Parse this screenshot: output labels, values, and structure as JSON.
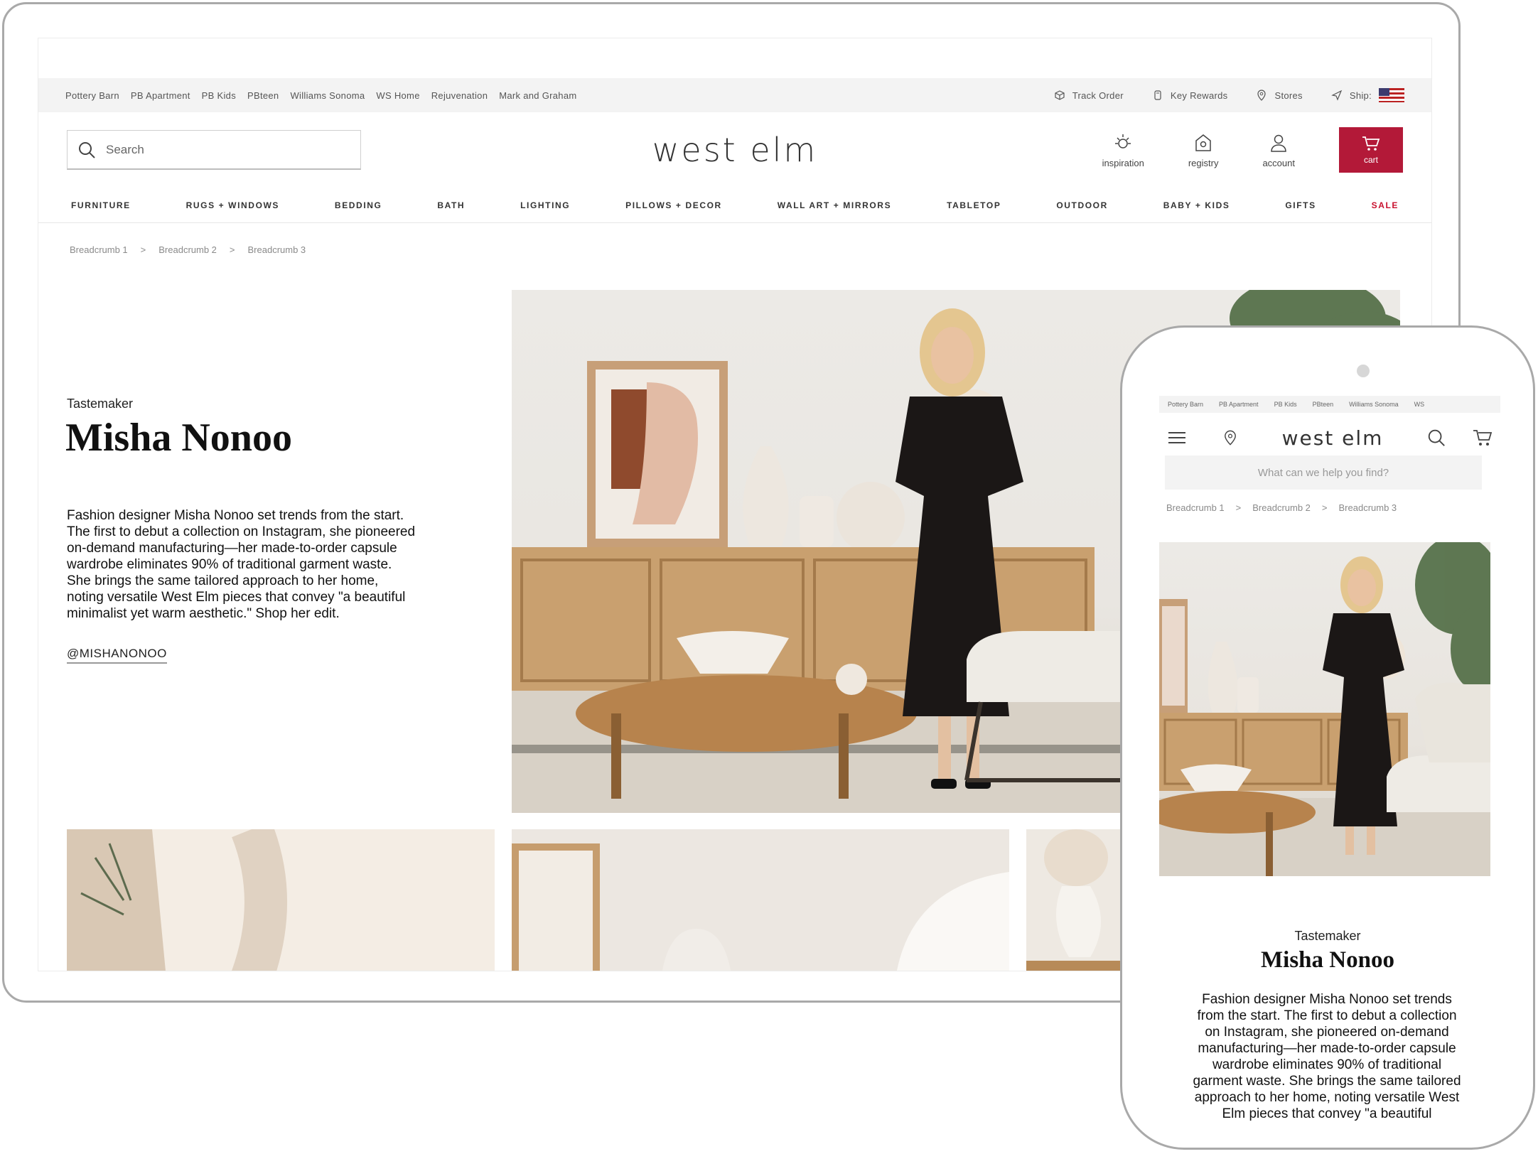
{
  "desktop": {
    "brand_links": [
      "Pottery Barn",
      "PB Apartment",
      "PB Kids",
      "PBteen",
      "Williams Sonoma",
      "WS Home",
      "Rejuvenation",
      "Mark and Graham"
    ],
    "utilities": {
      "track_order": "Track Order",
      "key_rewards": "Key Rewards",
      "stores": "Stores",
      "ship": "Ship:"
    },
    "search_placeholder": "Search",
    "logo": "west elm",
    "header_icons": {
      "inspiration": "inspiration",
      "registry": "registry",
      "account": "account",
      "cart": "cart"
    },
    "categories": [
      "FURNITURE",
      "RUGS + WINDOWS",
      "BEDDING",
      "BATH",
      "LIGHTING",
      "PILLOWS + DECOR",
      "WALL ART + MIRRORS",
      "TABLETOP",
      "OUTDOOR",
      "BABY + KIDS",
      "GIFTS",
      "SALE"
    ],
    "breadcrumbs": [
      "Breadcrumb 1",
      ">",
      "Breadcrumb 2",
      ">",
      "Breadcrumb 3"
    ],
    "eyebrow": "Tastemaker",
    "title": "Misha Nonoo",
    "bio_lines": [
      "Fashion designer Misha Nonoo set trends from the start.",
      "The first to debut a collection on Instagram, she pioneered",
      "on-demand manufacturing—her made-to-order capsule",
      "wardrobe eliminates 90% of traditional garment waste.",
      "She brings the same tailored approach to her home,",
      "noting versatile West Elm pieces that convey \"a beautiful",
      "minimalist yet warm aesthetic.\" Shop her edit."
    ],
    "handle": "@MISHANONOO"
  },
  "mobile": {
    "brand_links": [
      "Pottery Barn",
      "PB Apartment",
      "PB Kids",
      "PBteen",
      "Williams Sonoma",
      "WS"
    ],
    "logo": "west elm",
    "search_placeholder": "What can we help you find?",
    "breadcrumbs": [
      "Breadcrumb 1",
      ">",
      "Breadcrumb 2",
      ">",
      "Breadcrumb 3"
    ],
    "eyebrow": "Tastemaker",
    "title": "Misha Nonoo",
    "bio_lines": [
      "Fashion designer Misha Nonoo set trends",
      "from the start. The first to debut a collection",
      "on Instagram, she pioneered on-demand",
      "manufacturing—her made-to-order capsule",
      "wardrobe eliminates 90% of traditional",
      "garment waste. She brings the same tailored",
      "approach to her home, noting versatile West",
      "Elm pieces that convey \"a beautiful"
    ]
  },
  "colors": {
    "cart_red": "#b31938",
    "sale_red": "#c8102e",
    "brandbar_bg": "#f3f3f3"
  },
  "icons": [
    "search-icon",
    "track-order-icon",
    "key-rewards-icon",
    "store-pin-icon",
    "ship-arrow-icon",
    "us-flag-icon",
    "inspiration-sun-icon",
    "registry-icon",
    "account-icon",
    "cart-icon",
    "menu-icon",
    "location-pin-icon"
  ]
}
